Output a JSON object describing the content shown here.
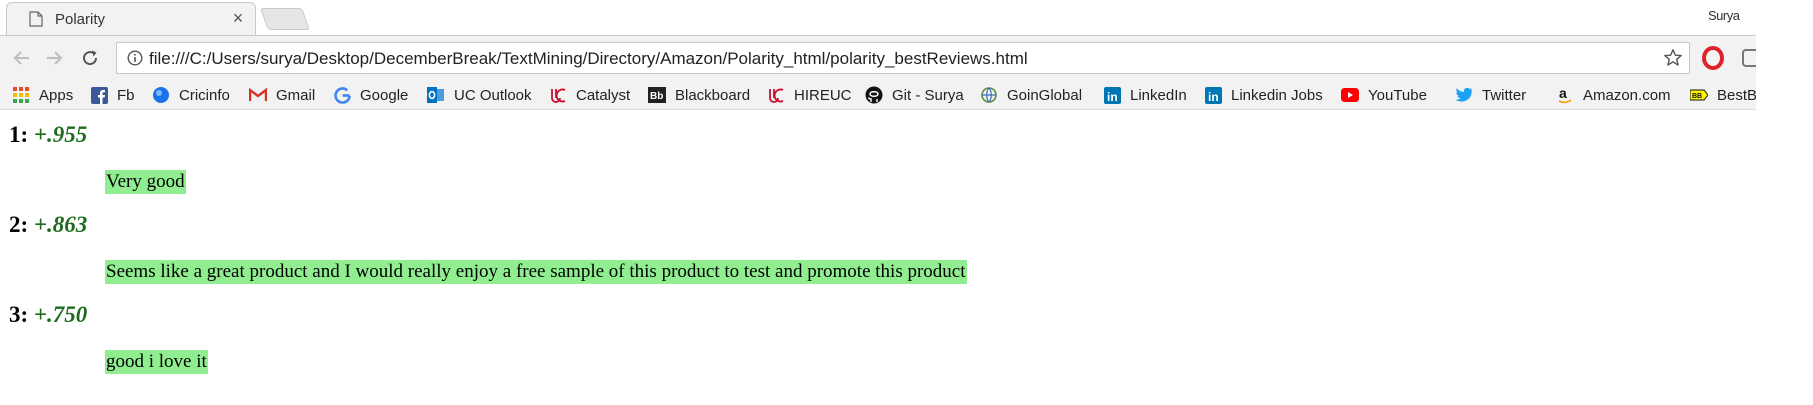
{
  "tab": {
    "title": "Polarity",
    "close_glyph": "×"
  },
  "profile": {
    "name": "Surya"
  },
  "toolbar": {
    "url": "file:///C:/Users/surya/Desktop/DecemberBreak/TextMining/Directory/Amazon/Polarity_html/polarity_bestReviews.html"
  },
  "bookmarks": [
    {
      "label": "Apps",
      "icon": "apps-grid-icon",
      "color": "#e44d26"
    },
    {
      "label": "Fb",
      "icon": "facebook-icon",
      "color": "#3b5998"
    },
    {
      "label": "Cricinfo",
      "icon": "cricinfo-icon",
      "color": "#1a73e8"
    },
    {
      "label": "Gmail",
      "icon": "gmail-icon",
      "color": "#d93025"
    },
    {
      "label": "Google",
      "icon": "google-icon",
      "color": "#4285f4"
    },
    {
      "label": "UC Outlook",
      "icon": "outlook-icon",
      "color": "#0072c6"
    },
    {
      "label": "Catalyst",
      "icon": "uc-icon",
      "color": "#c8102e"
    },
    {
      "label": "Blackboard",
      "icon": "blackboard-icon",
      "color": "#222222"
    },
    {
      "label": "HIREUC",
      "icon": "uc-icon",
      "color": "#c8102e"
    },
    {
      "label": "Git - Surya",
      "icon": "github-icon",
      "color": "#111111"
    },
    {
      "label": "GoinGlobal",
      "icon": "goinglobal-icon",
      "color": "#5a8f3c"
    },
    {
      "label": "LinkedIn",
      "icon": "linkedin-icon",
      "color": "#0077b5"
    },
    {
      "label": "Linkedin Jobs",
      "icon": "linkedin-icon",
      "color": "#0077b5"
    },
    {
      "label": "YouTube",
      "icon": "youtube-icon",
      "color": "#ff0000"
    },
    {
      "label": "Twitter",
      "icon": "twitter-icon",
      "color": "#1da1f2"
    },
    {
      "label": "Amazon.com",
      "icon": "amazon-icon",
      "color": "#111111"
    },
    {
      "label": "BestBuy",
      "icon": "bestbuy-icon",
      "color": "#fff200"
    }
  ],
  "reviews": [
    {
      "rank": "1:",
      "score": "+.955",
      "text": "Very good"
    },
    {
      "rank": "2:",
      "score": "+.863",
      "text": "Seems like a great product and I would really enjoy a free sample of this product to test and promote this product"
    },
    {
      "rank": "3:",
      "score": "+.750",
      "text": "good i love it"
    }
  ],
  "colors": {
    "highlight": "#90ee90",
    "score": "#1e6b1e"
  }
}
